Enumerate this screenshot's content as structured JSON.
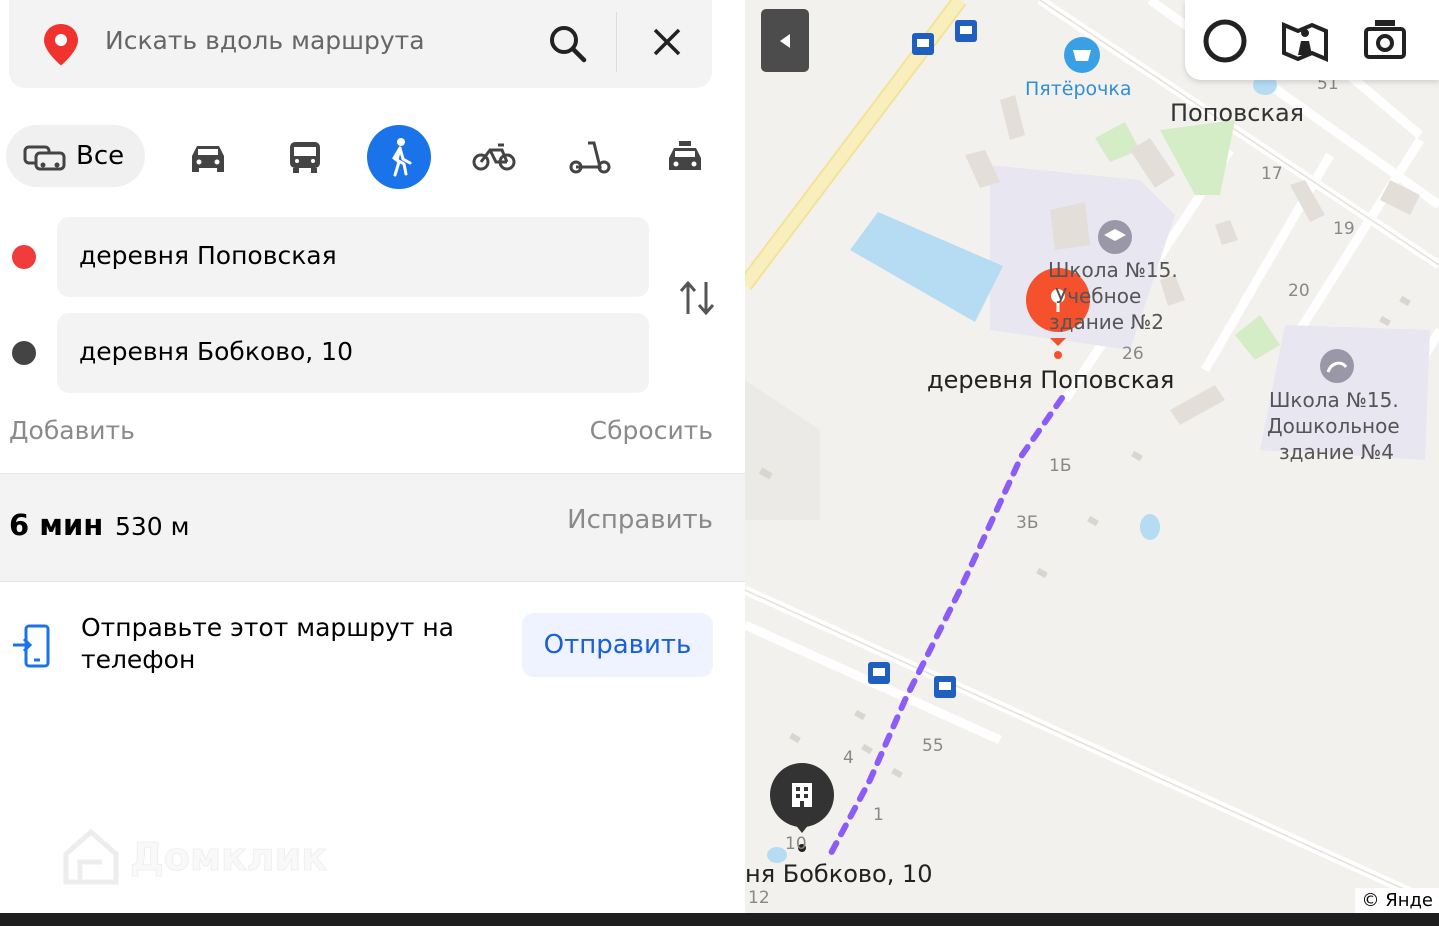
{
  "search": {
    "placeholder": "Искать вдоль маршрута"
  },
  "modes": {
    "all_label": "Все"
  },
  "route": {
    "from": "деревня Поповская",
    "to": "деревня Бобково, 10",
    "add_label": "Добавить",
    "reset_label": "Сбросить"
  },
  "summary": {
    "time": "6 мин",
    "distance": "530 м",
    "fix_label": "Исправить"
  },
  "send": {
    "text": "Отправьте этот маршрут на телефон",
    "button": "Отправить"
  },
  "watermark": "Домклик",
  "map": {
    "labels": {
      "shop": "Пятёрочка",
      "village": "Поповская",
      "school_line1": "Школа №15.",
      "school_line2": "Учебное",
      "school_line3": "здание №2",
      "kinder_line1": "Школа №15.",
      "kinder_line2": "Дошкольное",
      "kinder_line3": "здание №4",
      "start": "деревня Поповская",
      "end": "ня Бобково, 10",
      "copyright": "© Янде"
    },
    "house_numbers": [
      "51",
      "17",
      "19",
      "20",
      "26",
      "1Б",
      "3Б",
      "55",
      "4",
      "1",
      "10",
      "12"
    ],
    "route_color": "#8b5cf6",
    "start_color": "#f4512c"
  },
  "colors": {
    "accent": "#1a73e8",
    "start_dot": "#f23b3b",
    "end_dot": "#444444"
  }
}
